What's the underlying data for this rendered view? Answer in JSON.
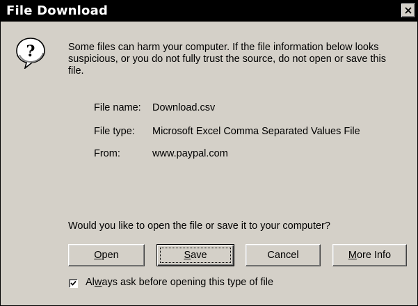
{
  "window": {
    "title": "File Download",
    "close_icon": "close-icon"
  },
  "icon": "question-mark-icon",
  "message": "Some files can harm your computer. If the file information below looks suspicious, or you do not fully trust the source, do not open or save this file.",
  "file_info": {
    "name_label": "File name:",
    "name_value": "Download.csv",
    "type_label": "File type:",
    "type_value": "Microsoft Excel Comma Separated Values File",
    "from_label": "From:",
    "from_value": "www.paypal.com"
  },
  "question": "Would you like to open the file or save it to your computer?",
  "buttons": {
    "open": {
      "mnemonic": "O",
      "rest": "pen"
    },
    "save": {
      "mnemonic": "S",
      "rest": "ave"
    },
    "cancel": "Cancel",
    "more_info": {
      "mnemonic": "M",
      "rest": "ore Info"
    }
  },
  "checkbox": {
    "checked": true,
    "label_pre": "Al",
    "label_mnemonic": "w",
    "label_post": "ays ask before opening this type of file"
  },
  "colors": {
    "dialog_bg": "#d4d0c8",
    "titlebar_bg": "#000000",
    "titlebar_text": "#ffffff"
  }
}
